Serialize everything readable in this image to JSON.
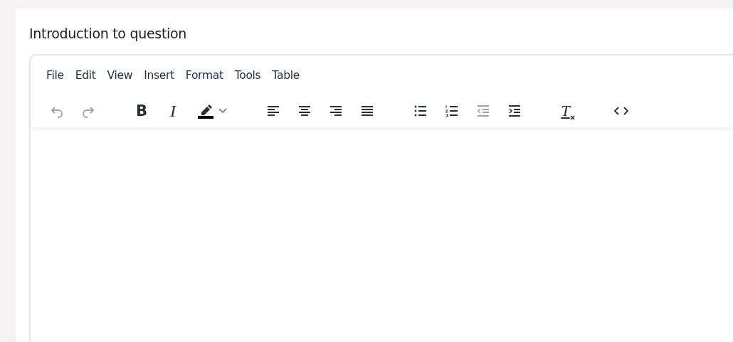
{
  "field": {
    "label": "Introduction to question"
  },
  "editor": {
    "menubar": [
      "File",
      "Edit",
      "View",
      "Insert",
      "Format",
      "Tools",
      "Table"
    ],
    "toolbar": [
      [
        {
          "kind": "undo",
          "disabled": true
        },
        {
          "kind": "redo",
          "disabled": true
        }
      ],
      [
        {
          "kind": "bold",
          "glyph": "B",
          "disabled": false
        },
        {
          "kind": "italic",
          "glyph": "I",
          "disabled": false
        },
        {
          "kind": "highlight",
          "disabled": false
        }
      ],
      [
        {
          "kind": "align-left",
          "disabled": false
        },
        {
          "kind": "align-center",
          "disabled": false
        },
        {
          "kind": "align-right",
          "disabled": false
        },
        {
          "kind": "justify",
          "disabled": false
        }
      ],
      [
        {
          "kind": "bullet-list",
          "disabled": false
        },
        {
          "kind": "numbered-list",
          "disabled": false
        },
        {
          "kind": "outdent",
          "disabled": true
        },
        {
          "kind": "indent",
          "disabled": false
        }
      ],
      [
        {
          "kind": "clear-format",
          "glyph": "T",
          "disabled": false
        }
      ],
      [
        {
          "kind": "code",
          "disabled": false
        }
      ]
    ]
  }
}
